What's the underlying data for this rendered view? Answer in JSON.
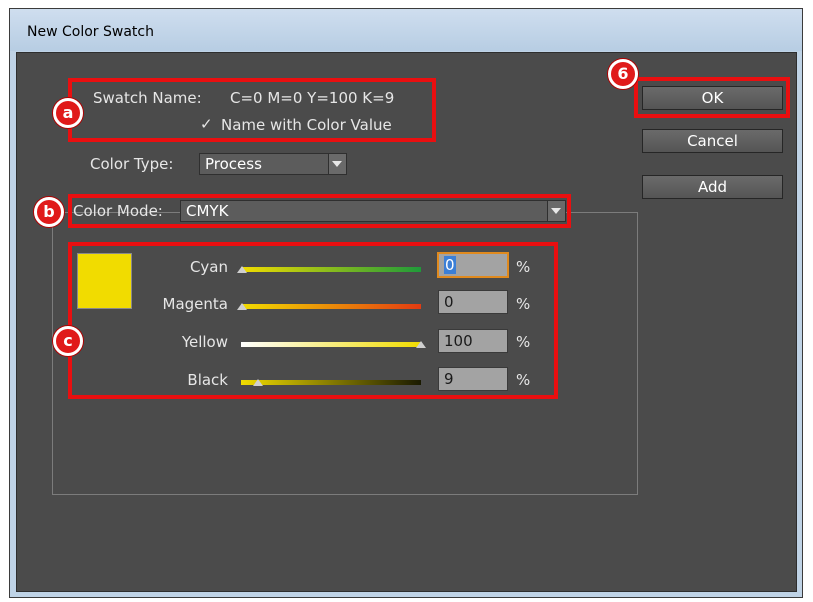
{
  "window": {
    "title": "New Color Swatch"
  },
  "swatch_name": {
    "label": "Swatch Name:",
    "value": "C=0 M=0 Y=100 K=9"
  },
  "name_with_color_value": {
    "label": "Name with Color Value",
    "checked": true
  },
  "color_type": {
    "label": "Color Type:",
    "value": "Process"
  },
  "color_mode": {
    "label": "Color Mode:",
    "value": "CMYK"
  },
  "buttons": {
    "ok": "OK",
    "cancel": "Cancel",
    "add": "Add"
  },
  "swatch_color": "#f1dc00",
  "sliders": [
    {
      "label": "Cyan",
      "value": "0",
      "unit": "%"
    },
    {
      "label": "Magenta",
      "value": "0",
      "unit": "%"
    },
    {
      "label": "Yellow",
      "value": "100",
      "unit": "%"
    },
    {
      "label": "Black",
      "value": "9",
      "unit": "%"
    }
  ],
  "annotations": {
    "a": "a",
    "b": "b",
    "c": "c",
    "step": "6"
  },
  "colors": {
    "highlight": "#ea0f10",
    "dialog_bg": "#4b4b4b"
  }
}
